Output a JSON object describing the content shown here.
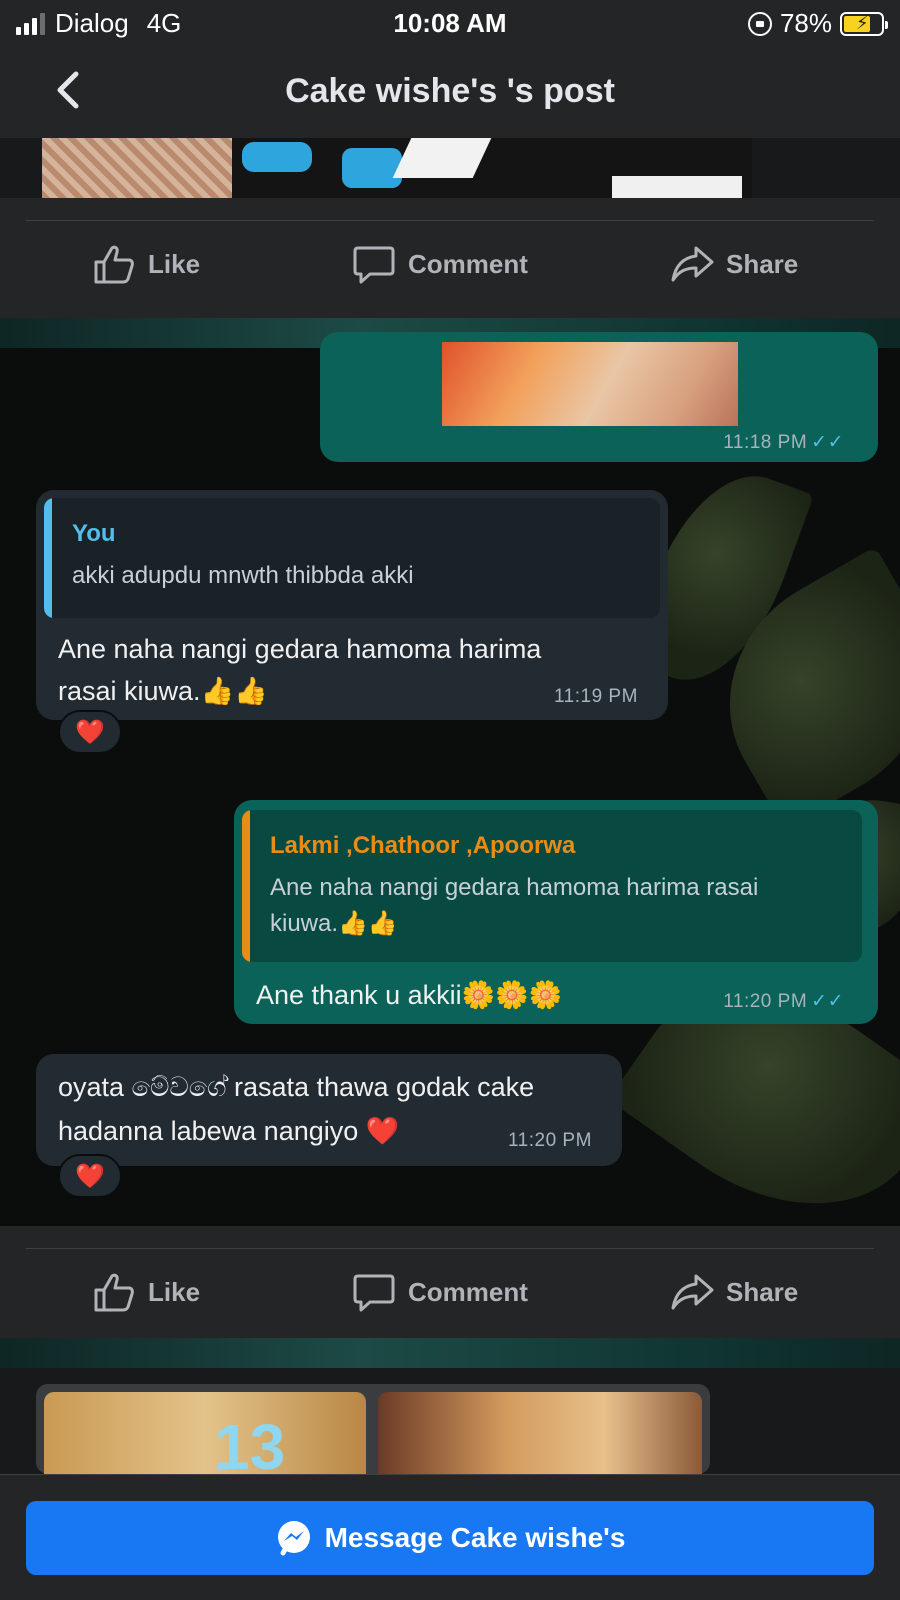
{
  "status_bar": {
    "carrier": "Dialog",
    "network": "4G",
    "time": "10:08 AM",
    "battery": "78%"
  },
  "header": {
    "title": "Cake wishe's 's post"
  },
  "actions": {
    "like": "Like",
    "comment": "Comment",
    "share": "Share"
  },
  "chat": {
    "messages": [
      {
        "direction": "outgoing",
        "type": "image",
        "time": "11:18 PM",
        "ticks": "✓✓"
      },
      {
        "direction": "incoming",
        "quote": {
          "name": "You",
          "text": "akki adupdu mnwth thibbda akki"
        },
        "text_line1": "Ane  naha nangi gedara hamoma  harima",
        "text_line2": "rasai kiuwa.👍👍",
        "time": "11:19 PM",
        "reaction": "❤️"
      },
      {
        "direction": "outgoing",
        "quote": {
          "name": "Lakmi ,Chathoor ,Apoorwa",
          "text_line1": "Ane  naha nangi gedara hamoma  harima rasai",
          "text_line2": "kiuwa.👍👍"
        },
        "text": "Ane thank u akkii🌼🌼🌼",
        "time": "11:20 PM",
        "ticks": "✓✓"
      },
      {
        "direction": "incoming",
        "text_line1": "oyata මේවගේ rasata thawa godak cake",
        "text_line2": "hadanna labewa nangiyo ❤️",
        "time": "11:20 PM",
        "reaction": "❤️"
      }
    ]
  },
  "bottom_photo": {
    "overlay_number": "13"
  },
  "message_button": {
    "label": "Message Cake wishe's"
  },
  "colors": {
    "accent": "#1877f2",
    "outgoing_bubble": "#0b6258",
    "incoming_bubble": "#222b32",
    "quote_you": "#53bdeb",
    "quote_group": "#e88c16",
    "read_ticks": "#53bdeb"
  }
}
